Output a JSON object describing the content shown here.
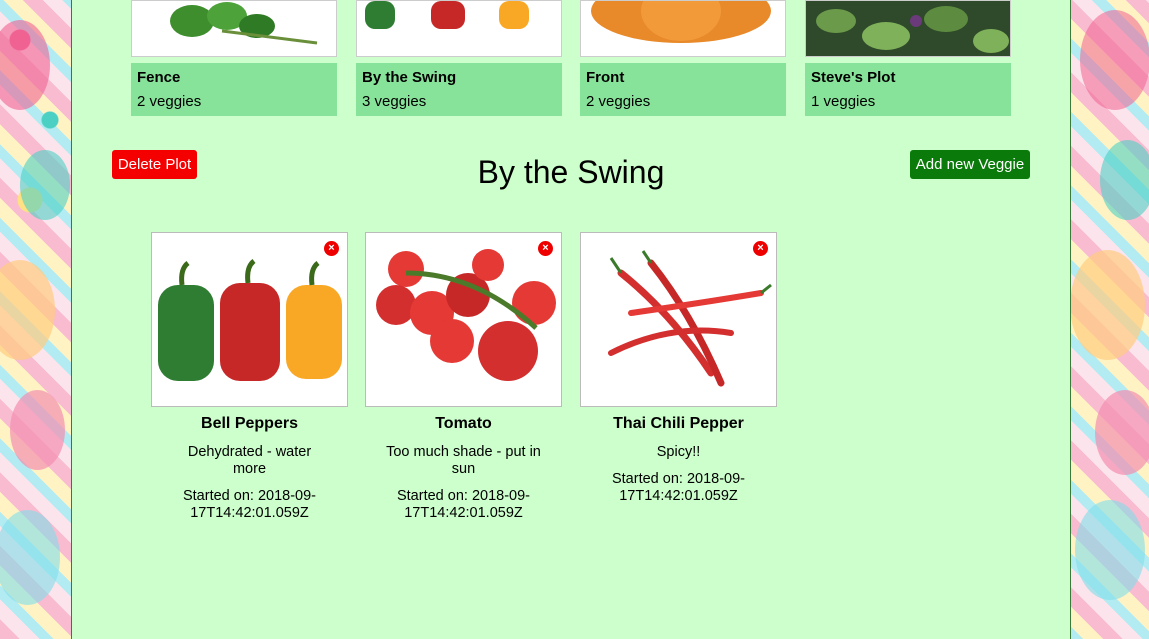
{
  "plots": [
    {
      "name": "Fence",
      "count": "2 veggies"
    },
    {
      "name": "By the Swing",
      "count": "3 veggies"
    },
    {
      "name": "Front",
      "count": "2 veggies"
    },
    {
      "name": "Steve's Plot",
      "count": "1 veggies"
    }
  ],
  "actions": {
    "delete_label": "Delete Plot",
    "add_label": "Add new Veggie"
  },
  "current_plot": {
    "title": "By the Swing"
  },
  "veggies": [
    {
      "name": "Bell Peppers",
      "note": "Dehydrated - water more",
      "started": "Started on: 2018-09-17T14:42:01.059Z"
    },
    {
      "name": "Tomato",
      "note": "Too much shade - put in sun",
      "started": "Started on: 2018-09-17T14:42:01.059Z"
    },
    {
      "name": "Thai Chili Pepper",
      "note": "Spicy!!",
      "started": "Started on: 2018-09-17T14:42:01.059Z"
    }
  ],
  "colors": {
    "background": "#ccffcc",
    "plot_info": "#88e39a",
    "delete_button": "#f50000",
    "add_button": "#0a7a0a",
    "close_badge": "#e00000"
  },
  "icons": {
    "remove": "close-icon"
  }
}
